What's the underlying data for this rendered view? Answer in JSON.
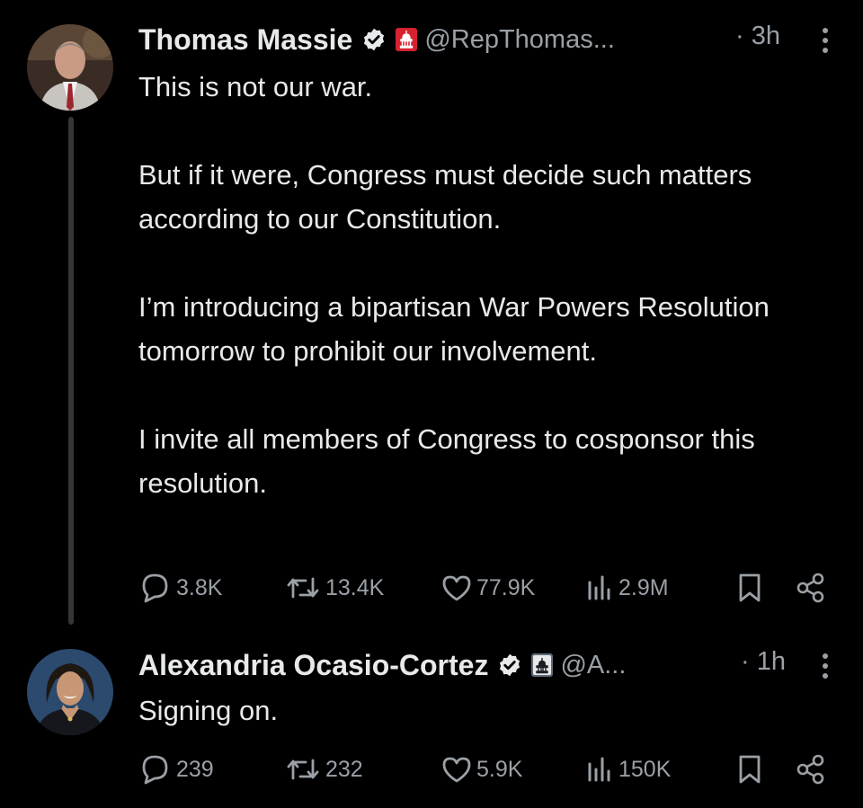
{
  "tweets": [
    {
      "author_name": "Thomas Massie",
      "handle": "@RepThomas...",
      "time": "· 3h",
      "text": "This is not our war.\n\nBut if it were, Congress must decide such matters according to our Constitution.\n\nI’m introducing a bipartisan War Powers Resolution tomorrow to prohibit our involvement.\n\nI invite all members of Congress to cosponsor this resolution.",
      "replies": "3.8K",
      "reposts": "13.4K",
      "likes": "77.9K",
      "views": "2.9M"
    },
    {
      "author_name": "Alexandria Ocasio-Cortez",
      "handle": "@A...",
      "time": "· 1h",
      "text": "Signing on.",
      "replies": "239",
      "reposts": "232",
      "likes": "5.9K",
      "views": "150K"
    }
  ],
  "icons": {
    "verified": "verified-badge-icon",
    "gov_badge_1": "government-red-capitol-icon",
    "gov_badge_2": "government-gray-capitol-icon",
    "reply": "reply-bubble-icon",
    "repost": "repost-arrows-icon",
    "like": "heart-icon",
    "views": "bar-chart-icon",
    "bookmark": "bookmark-icon",
    "share": "share-icon",
    "more": "more-vertical-icon"
  },
  "colors": {
    "background": "#000000",
    "text": "#e7e9ea",
    "secondary": "#9aa0a6",
    "verified": "#e7e9ea",
    "gov_red": "#d6212f",
    "gov_gray": "#5f6b78"
  }
}
